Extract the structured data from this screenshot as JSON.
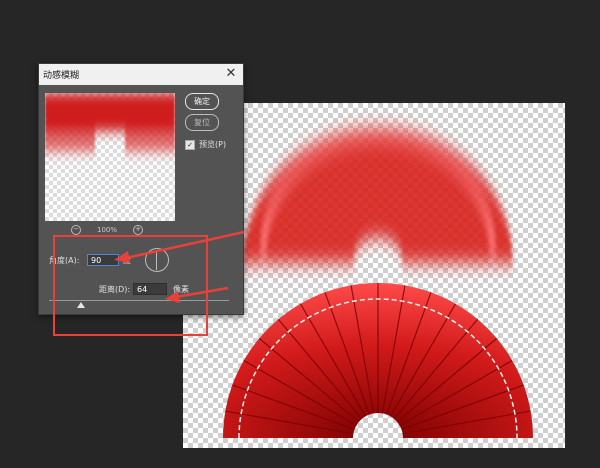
{
  "dialog": {
    "title": "动感模糊",
    "close_icon": "close-icon",
    "ok_label": "确定",
    "reset_label": "复位",
    "preview_label": "预览(P)",
    "preview_checked": true,
    "zoom_level": "100%",
    "zoom_out_icon": "zoom-out-icon",
    "zoom_in_icon": "zoom-in-icon",
    "angle_label": "角度(A):",
    "angle_value": "90",
    "angle_unit": "度",
    "distance_label": "距离(D):",
    "distance_value": "64",
    "distance_unit": "像素"
  },
  "colors": {
    "fan_red": "#d21a1a",
    "annotation_red": "#e8413a",
    "panel": "#535353",
    "background": "#262626"
  }
}
